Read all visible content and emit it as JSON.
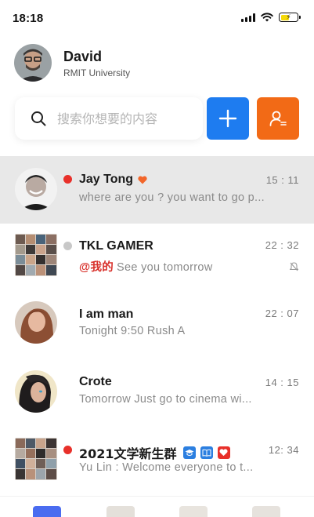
{
  "status": {
    "time": "18:18",
    "battery_percent": 55
  },
  "profile": {
    "name": "David",
    "org": "RMIT University"
  },
  "search": {
    "placeholder": "搜索你想要的内容"
  },
  "chats": [
    {
      "name": "Jay Tong",
      "time": "15 : 11",
      "preview": "where are you ? you want to go p...",
      "mention": "",
      "dot_color": "#e8302a",
      "selected": true
    },
    {
      "name": "TKL GAMER",
      "time": "22 : 32",
      "preview": "See you tomorrow",
      "mention": "@我的",
      "dot_color": "#c8c8c8",
      "selected": false
    },
    {
      "name": "I am man",
      "time": "22 : 07",
      "preview": "Tonight 9:50  Rush A",
      "mention": "",
      "dot_color": "",
      "selected": false
    },
    {
      "name": "Crote",
      "time": "14 : 15",
      "preview": "Tomorrow Just go to cinema wi...",
      "mention": "",
      "dot_color": "",
      "selected": false
    },
    {
      "name": "2021文学新生群",
      "time": "12: 34",
      "preview": "Yu Lin : Welcome  everyone to t...",
      "mention": "",
      "dot_color": "#e8302a",
      "selected": false
    }
  ],
  "colors": {
    "primary_blue": "#1e7cf0",
    "accent_orange": "#f26a16",
    "unread_red": "#e8302a",
    "heart_orange": "#f2662a"
  }
}
